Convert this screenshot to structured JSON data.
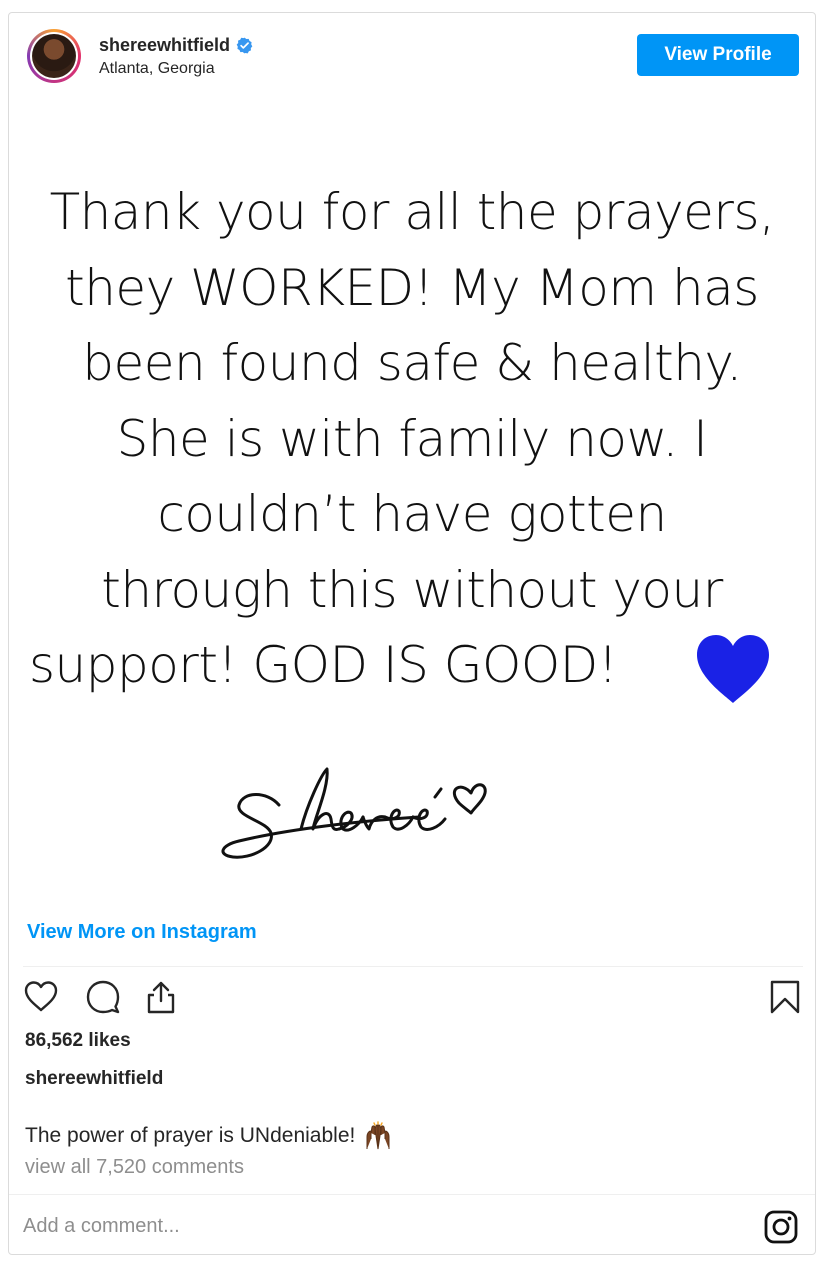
{
  "header": {
    "username": "shereewhitfield",
    "verified_icon": "verified-badge-icon",
    "location": "Atlanta, Georgia",
    "view_profile_label": "View Profile"
  },
  "post": {
    "quote_lines": [
      "Thank you for all the prayers,",
      "they WORKED! My Mom has",
      "been found safe & healthy.",
      "She is with family now. I",
      "couldn’t have gotten",
      "through this without your",
      "support! GOD IS GOOD!"
    ],
    "emoji": "blue-heart-icon",
    "signature_text": "Sheree"
  },
  "links": {
    "view_more": "View More on Instagram"
  },
  "actions": {
    "like_icon": "heart-outline-icon",
    "comment_icon": "comment-icon",
    "share_icon": "share-icon",
    "save_icon": "bookmark-icon"
  },
  "stats": {
    "likes": "86,562 likes"
  },
  "caption": {
    "user": "shereewhitfield",
    "text": "The power of prayer is UNdeniable!",
    "emoji": "raising-hands-icon"
  },
  "comments": {
    "view_all": "view all 7,520 comments",
    "placeholder": "Add a comment..."
  },
  "colors": {
    "accent": "#0095f6",
    "text": "#262626",
    "muted": "#8e8e8e",
    "heart_blue": "#1a22e6"
  }
}
